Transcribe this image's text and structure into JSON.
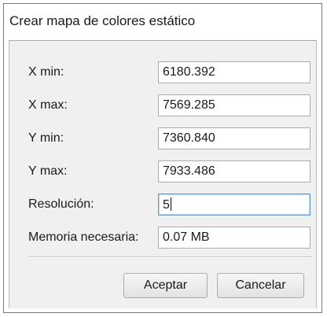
{
  "dialog": {
    "title": "Crear mapa de colores estático",
    "fields": [
      {
        "label": "X min:",
        "value": "6180.392"
      },
      {
        "label": "X max:",
        "value": "7569.285"
      },
      {
        "label": "Y min:",
        "value": "7360.840"
      },
      {
        "label": "Y max:",
        "value": "7933.486"
      },
      {
        "label": "Resolución:",
        "value": "5"
      },
      {
        "label": "Memoria necesaria:",
        "value": "0.07 MB"
      }
    ],
    "buttons": {
      "ok_label": "Aceptar",
      "cancel_label": "Cancelar"
    }
  }
}
